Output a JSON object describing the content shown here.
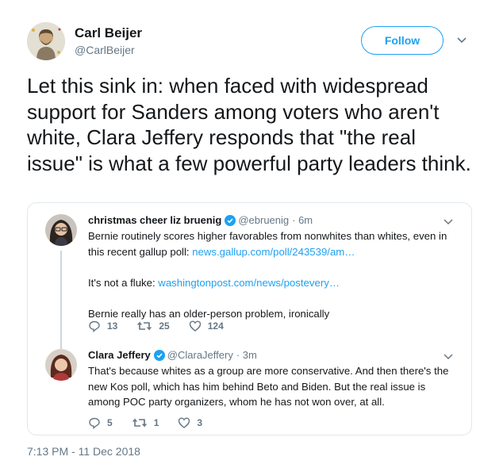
{
  "author": {
    "name": "Carl Beijer",
    "handle": "@CarlBeijer",
    "follow_label": "Follow"
  },
  "tweet": {
    "text": "Let this sink in: when faced with widespread support for Sanders among voters who aren't white, Clara Jeffery responds that \"the real issue\" is what a few powerful party leaders think.",
    "timestamp": "7:13 PM - 11 Dec 2018"
  },
  "quoted": [
    {
      "name": "christmas cheer liz bruenig",
      "handle": "@ebruenig",
      "time": "· 6m",
      "verified": true,
      "p1_text": "Bernie routinely scores higher favorables from nonwhites than whites, even in this recent gallup poll: ",
      "p1_link": "news.gallup.com/poll/243539/am…",
      "p2_text": "It's not a fluke: ",
      "p2_link": "washingtonpost.com/news/postevery…",
      "p3_text": "Bernie really has an older-person problem, ironically",
      "replies": "13",
      "retweets": "25",
      "likes": "124"
    },
    {
      "name": "Clara Jeffery",
      "handle": "@ClaraJeffery",
      "time": "· 3m",
      "verified": true,
      "p1_text": "That's because whites as a group are more conservative. And then there's the new Kos poll, which has him behind Beto and Biden. But the real issue is among POC party organizers, whom he has not won over, at all.",
      "replies": "5",
      "retweets": "1",
      "likes": "3"
    }
  ],
  "colors": {
    "accent": "#1da1f2",
    "secondary_text": "#657786",
    "border": "#e1e8ed"
  },
  "icons": [
    "chevron-down-icon",
    "verified-badge-icon",
    "reply-icon",
    "retweet-icon",
    "like-icon"
  ]
}
